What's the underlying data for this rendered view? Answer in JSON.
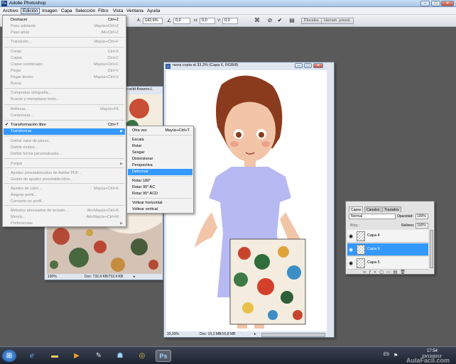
{
  "app": {
    "title": "Adobe Photoshop",
    "logo": "Ps",
    "window_buttons": [
      "–",
      "□",
      "✕"
    ]
  },
  "menubar": {
    "items": [
      "Archivo",
      "Edición",
      "Imagen",
      "Capa",
      "Selección",
      "Filtro",
      "Vista",
      "Ventana",
      "Ayuda"
    ],
    "active": "Edición"
  },
  "options_bar": {
    "angle_label": "Á:",
    "angle_value": "142,6%",
    "field2_value": "0,0",
    "h_label": "H:",
    "h_value": "0,0",
    "v_label": "V:",
    "v_value": "0,0",
    "panel_tabs": [
      "Pinceles",
      "Herram. preest."
    ]
  },
  "edit_menu": {
    "items": [
      {
        "label": "Deshacer",
        "shortcut": "Ctrl+Z",
        "enabled": true
      },
      {
        "label": "Paso adelante",
        "shortcut": "Mayús+Ctrl+Z",
        "enabled": false
      },
      {
        "label": "Paso atrás",
        "shortcut": "Alt+Ctrl+Z",
        "enabled": false
      },
      {
        "label": "Transición...",
        "shortcut": "Mayús+Ctrl+F",
        "enabled": false
      },
      {
        "label": "Cortar",
        "shortcut": "Ctrl+X",
        "enabled": false
      },
      {
        "label": "Copiar",
        "shortcut": "Ctrl+C",
        "enabled": false
      },
      {
        "label": "Copiar combinado",
        "shortcut": "Mayús+Ctrl+C",
        "enabled": false
      },
      {
        "label": "Pegar",
        "shortcut": "Ctrl+V",
        "enabled": false
      },
      {
        "label": "Pegar dentro",
        "shortcut": "Mayús+Ctrl+V",
        "enabled": false
      },
      {
        "label": "Borrar",
        "shortcut": "",
        "enabled": false
      },
      {
        "label": "Comprobar ortografía...",
        "shortcut": "",
        "enabled": false
      },
      {
        "label": "Buscar y reemplazar texto...",
        "shortcut": "",
        "enabled": false
      },
      {
        "label": "Rellenar...",
        "shortcut": "Mayús+F5",
        "enabled": false
      },
      {
        "label": "Contornear...",
        "shortcut": "",
        "enabled": false
      },
      {
        "label": "Transformación libre",
        "shortcut": "Ctrl+T",
        "enabled": true,
        "checked": true
      },
      {
        "label": "Transformar",
        "shortcut": "",
        "enabled": true,
        "submenu": true,
        "selected": true
      },
      {
        "label": "Definir valor de pincel...",
        "shortcut": "",
        "enabled": false
      },
      {
        "label": "Definir motivo...",
        "shortcut": "",
        "enabled": false
      },
      {
        "label": "Definir forma personalizada...",
        "shortcut": "",
        "enabled": false
      },
      {
        "label": "Purgar",
        "shortcut": "",
        "enabled": false,
        "submenu": true
      },
      {
        "label": "Ajustes preestablecidos de Adobe PDF...",
        "shortcut": "",
        "enabled": false
      },
      {
        "label": "Gestor de ajustes preestablecidos...",
        "shortcut": "",
        "enabled": false
      },
      {
        "label": "Ajustes de color...",
        "shortcut": "Mayús+Ctrl+K",
        "enabled": false
      },
      {
        "label": "Asignar perfil...",
        "shortcut": "",
        "enabled": false
      },
      {
        "label": "Convertir en perfil...",
        "shortcut": "",
        "enabled": false
      },
      {
        "label": "Métodos abreviados de teclado...",
        "shortcut": "Alt+Mayús+Ctrl+K",
        "enabled": false
      },
      {
        "label": "Menús...",
        "shortcut": "Alt+Mayús+Ctrl+M",
        "enabled": false
      },
      {
        "label": "Preferencias",
        "shortcut": "",
        "enabled": false,
        "submenu": true
      }
    ]
  },
  "transform_menu": {
    "items": [
      {
        "label": "Otra vez",
        "shortcut": "Mayús+Ctrl+T"
      },
      {
        "label": "Escala",
        "shortcut": ""
      },
      {
        "label": "Rotar",
        "shortcut": ""
      },
      {
        "label": "Sesgar",
        "shortcut": ""
      },
      {
        "label": "Distorsionar",
        "shortcut": ""
      },
      {
        "label": "Perspectiva",
        "shortcut": ""
      },
      {
        "label": "Deformar",
        "shortcut": "",
        "selected": true
      },
      {
        "label": "Rotar 180°",
        "shortcut": ""
      },
      {
        "label": "Rotar 90° AC",
        "shortcut": ""
      },
      {
        "label": "Rotar 90° ACD",
        "shortcut": ""
      },
      {
        "label": "Voltear horizontal",
        "shortcut": ""
      },
      {
        "label": "Voltear vertical",
        "shortcut": ""
      }
    ]
  },
  "doc_back": {
    "title_fragment": "th-wild-flowers-L",
    "zoom": "100%",
    "doc_info": "Doc: 732,4 KB/732,4 KB"
  },
  "doc_main": {
    "title": "nena copia al 33,3% (Capa 6, RGB/8)",
    "zoom": "33,33%",
    "doc_info": "Doc: 15,3 MB/16,8 MB"
  },
  "layers_panel": {
    "tabs": [
      "Capas",
      "Canales",
      "Trazados"
    ],
    "active_tab": "Capas",
    "blend_mode": "Normal",
    "opacity_label": "Opacidad:",
    "opacity_value": "100%",
    "lock_label": "Bloq.:",
    "fill_label": "Relleno:",
    "fill_value": "100%",
    "layers": [
      {
        "name": "Capa 4",
        "selected": false
      },
      {
        "name": "Capa 6",
        "selected": true
      },
      {
        "name": "Capa 5",
        "selected": false
      }
    ]
  },
  "taskbar": {
    "language": "ES",
    "time": "17:54",
    "date": "23/12/2012"
  },
  "watermark": "AulaFacil.com",
  "colors": {
    "menu_highlight": "#3399ff",
    "taskbar_bg": "#1d2330",
    "canvas_bg": "#5a5a5a"
  }
}
